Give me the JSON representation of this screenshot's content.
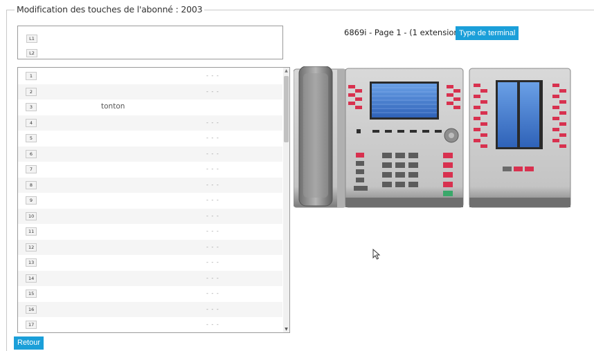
{
  "fieldset": {
    "legend": "Modification des touches de l'abonné : 2003"
  },
  "lines": [
    {
      "key": "L1"
    },
    {
      "key": "L2"
    }
  ],
  "keys": [
    {
      "num": "1",
      "label": "",
      "value": "- - -"
    },
    {
      "num": "2",
      "label": "",
      "value": "- - -"
    },
    {
      "num": "3",
      "label": "tonton",
      "value": ""
    },
    {
      "num": "4",
      "label": "",
      "value": "- - -"
    },
    {
      "num": "5",
      "label": "",
      "value": "- - -"
    },
    {
      "num": "6",
      "label": "",
      "value": "- - -"
    },
    {
      "num": "7",
      "label": "",
      "value": "- - -"
    },
    {
      "num": "8",
      "label": "",
      "value": "- - -"
    },
    {
      "num": "9",
      "label": "",
      "value": "- - -"
    },
    {
      "num": "10",
      "label": "",
      "value": "- - -"
    },
    {
      "num": "11",
      "label": "",
      "value": "- - -"
    },
    {
      "num": "12",
      "label": "",
      "value": "- - -"
    },
    {
      "num": "13",
      "label": "",
      "value": "- - -"
    },
    {
      "num": "14",
      "label": "",
      "value": "- - -"
    },
    {
      "num": "15",
      "label": "",
      "value": "- - -"
    },
    {
      "num": "16",
      "label": "",
      "value": "- - -"
    },
    {
      "num": "17",
      "label": "",
      "value": "- - -"
    }
  ],
  "header": {
    "info": "6869i - Page 1 - (1 extension(s))",
    "type_button": "Type de terminal"
  },
  "footer": {
    "back_button": "Retour"
  },
  "colors": {
    "accent": "#1b9fd9",
    "phone_key_red": "#d8314f",
    "screen_blue": "#3f74c9"
  },
  "icons": {
    "scroll_up": "▲",
    "scroll_down": "▼"
  }
}
